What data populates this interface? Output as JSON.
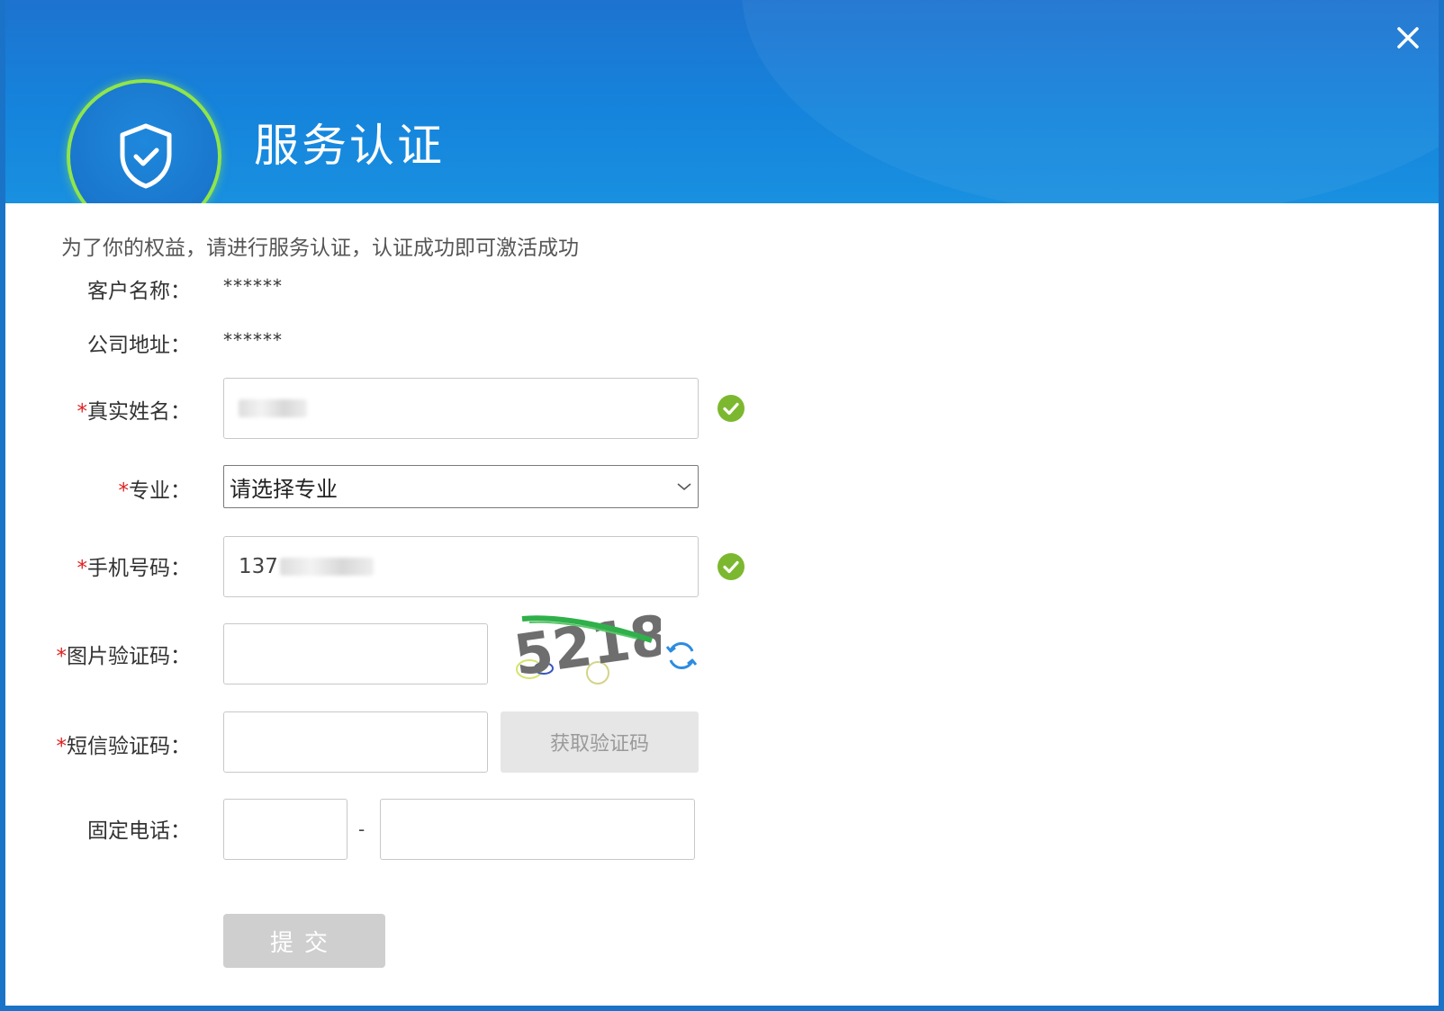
{
  "header": {
    "title": "服务认证",
    "close_icon": "close-icon",
    "badge_icon": "shield-check-icon"
  },
  "intro": "为了你的权益，请进行服务认证，认证成功即可激活成功",
  "fields": {
    "customer_name": {
      "label": "客户名称：",
      "value": "******"
    },
    "company_address": {
      "label": "公司地址：",
      "value": "******"
    },
    "real_name": {
      "required": "*",
      "label": "真实姓名：",
      "value": "",
      "valid": true
    },
    "major": {
      "required": "*",
      "label": "专业：",
      "selected": "请选择专业"
    },
    "phone": {
      "required": "*",
      "label": "手机号码：",
      "value_prefix": "137",
      "valid": true
    },
    "image_code": {
      "required": "*",
      "label": "图片验证码：",
      "value": "",
      "captcha_text": "5218"
    },
    "sms_code": {
      "required": "*",
      "label": "短信验证码：",
      "value": "",
      "button": "获取验证码"
    },
    "landline": {
      "label": "固定电话：",
      "separator": "-"
    }
  },
  "submit_label": "提交",
  "colors": {
    "header": "#1584dc",
    "accent_green": "#7cb82f",
    "badge_ring": "#8fe54b"
  }
}
